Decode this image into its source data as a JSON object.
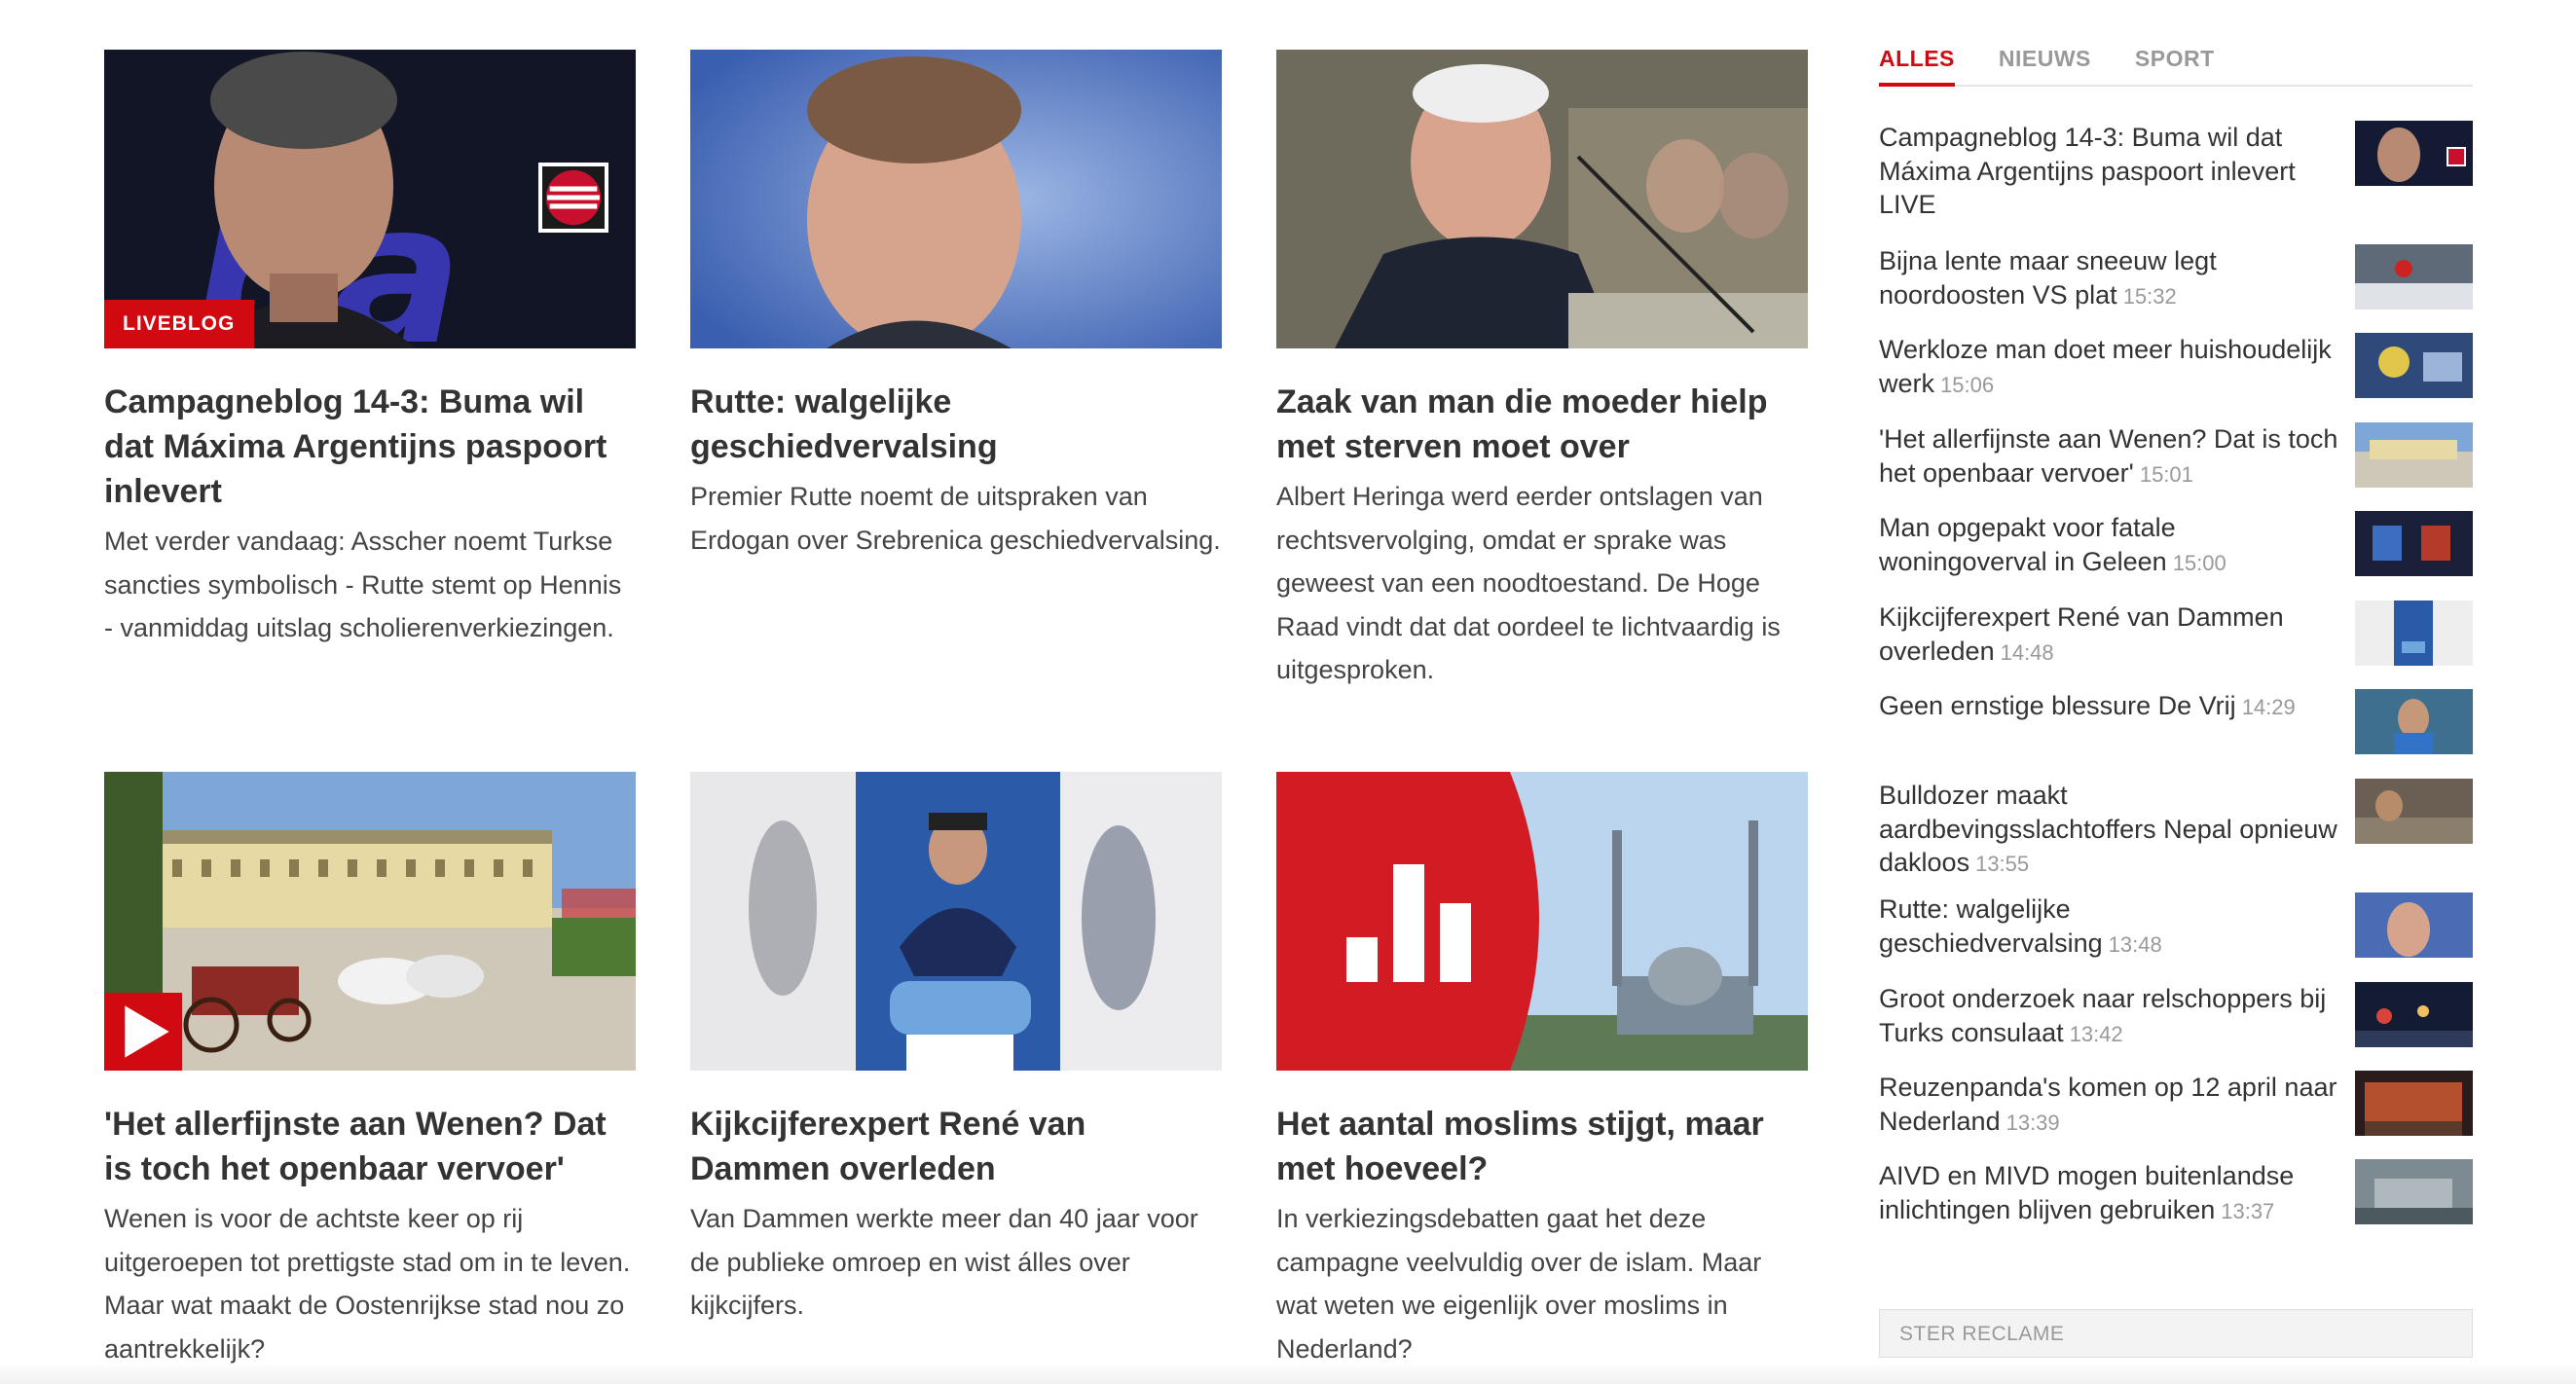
{
  "cards": [
    {
      "title": "Campagneblog 14-3: Buma wil dat Máxima Argentijns paspoort inlevert",
      "text": "Met verder vandaag: Asscher noemt Turkse sancties symbolisch - Rutte stemt op Hennis - vanmiddag uitslag scholierenverkiezingen.",
      "badge": "LIVEBLOG"
    },
    {
      "title": "Rutte: walgelijke geschiedvervalsing",
      "text": "Premier Rutte noemt de uitspraken van Erdogan over Srebrenica geschiedvervalsing."
    },
    {
      "title": "Zaak van man die moeder hielp met sterven moet over",
      "text": "Albert Heringa werd eerder ontslagen van rechtsvervolging, omdat er sprake was geweest van een noodtoestand. De Hoge Raad vindt dat dat oordeel te lichtvaardig is uitgesproken."
    },
    {
      "title": "'Het allerfijnste aan Wenen? Dat is toch het openbaar vervoer'",
      "text": "Wenen is voor de achtste keer op rij uitgeroepen tot prettigste stad om in te leven. Maar wat maakt de Oostenrijkse stad nou zo aantrekkelijk?"
    },
    {
      "title": "Kijkcijferexpert René van Dammen overleden",
      "text": "Van Dammen werkte meer dan 40 jaar voor de publieke omroep en wist álles over kijkcijfers."
    },
    {
      "title": "Het aantal moslims stijgt, maar met hoeveel?",
      "text": "In verkiezingsdebatten gaat het deze campagne veelvuldig over de islam. Maar wat weten we eigenlijk over moslims in Nederland?"
    }
  ],
  "sidebar": {
    "tabs": [
      "ALLES",
      "NIEUWS",
      "SPORT"
    ],
    "items": [
      {
        "title": "Campagneblog 14-3: Buma wil dat Máxima Argentijns paspoort inlevert LIVE",
        "time": ""
      },
      {
        "title": "Bijna lente maar sneeuw legt noordoosten VS plat",
        "time": "15:32"
      },
      {
        "title": "Werkloze man doet meer huishoudelijk werk",
        "time": "15:06"
      },
      {
        "title": "'Het allerfijnste aan Wenen? Dat is toch het openbaar vervoer'",
        "time": "15:01"
      },
      {
        "title": "Man opgepakt voor fatale woningoverval in Geleen",
        "time": "15:00"
      },
      {
        "title": "Kijkcijferexpert René van Dammen overleden",
        "time": "14:48"
      },
      {
        "title": "Geen ernstige blessure De Vrij",
        "time": "14:29"
      },
      {
        "title": "Bulldozer maakt aardbevingsslachtoffers Nepal opnieuw dakloos",
        "time": "13:55"
      },
      {
        "title": "Rutte: walgelijke geschiedvervalsing",
        "time": "13:48"
      },
      {
        "title": "Groot onderzoek naar relschoppers bij Turks consulaat",
        "time": "13:42"
      },
      {
        "title": "Reuzenpanda's komen op 12 april naar Nederland",
        "time": "13:39"
      },
      {
        "title": "AIVD en MIVD mogen buitenlandse inlichtingen blijven gebruiken",
        "time": "13:37"
      }
    ],
    "ad_label": "STER RECLAME"
  },
  "colors": {
    "accent": "#d10a11",
    "text": "#333333",
    "muted": "#999999"
  }
}
